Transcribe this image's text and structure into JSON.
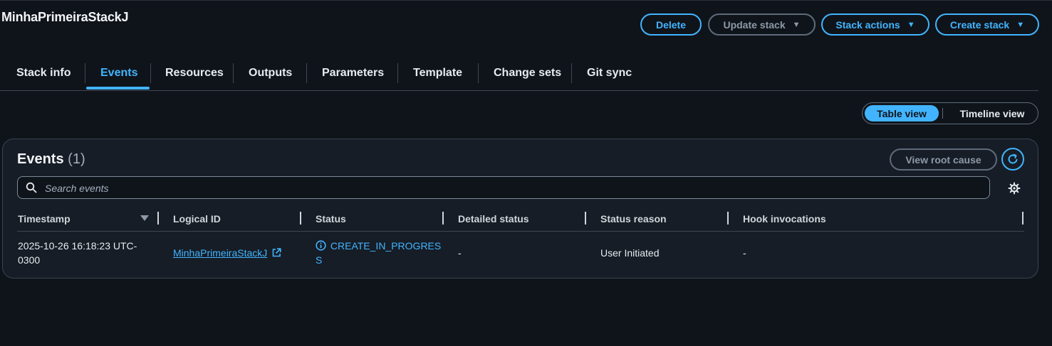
{
  "stack": {
    "name": "MinhaPrimeiraStackJ"
  },
  "header_buttons": {
    "delete": "Delete",
    "update_stack": "Update stack",
    "stack_actions": "Stack actions",
    "create_stack": "Create stack"
  },
  "tabs": [
    "Stack info",
    "Events",
    "Resources",
    "Outputs",
    "Parameters",
    "Template",
    "Change sets",
    "Git sync"
  ],
  "active_tab": "Events",
  "view_toggle": {
    "table_view": "Table view",
    "timeline_view": "Timeline view",
    "selected": "Table view"
  },
  "events_panel": {
    "title": "Events",
    "count": "(1)",
    "view_root_cause": "View root cause",
    "search_placeholder": "Search events",
    "columns": [
      "Timestamp",
      "Logical ID",
      "Status",
      "Detailed status",
      "Status reason",
      "Hook invocations"
    ],
    "rows": [
      {
        "timestamp_line1": "2025-10-26 16:18:23 UTC-",
        "timestamp_line2": "0300",
        "logical_id": "MinhaPrimeiraStackJ",
        "status_line1": "CREATE_IN_PROGRES",
        "status_line2": "S",
        "detailed_status": "-",
        "status_reason": "User Initiated",
        "hook_invocations": "-"
      }
    ]
  },
  "icons": {
    "caret": "caret-down-icon",
    "refresh": "refresh-icon",
    "search": "search-icon",
    "settings": "gear-icon",
    "external_link": "external-link-icon",
    "info": "info-icon",
    "sort": "sort-down-icon"
  },
  "colors": {
    "background": "#0f141a",
    "panel": "#161d26",
    "accent": "#42b4ff",
    "disabled": "#8d99a8"
  }
}
